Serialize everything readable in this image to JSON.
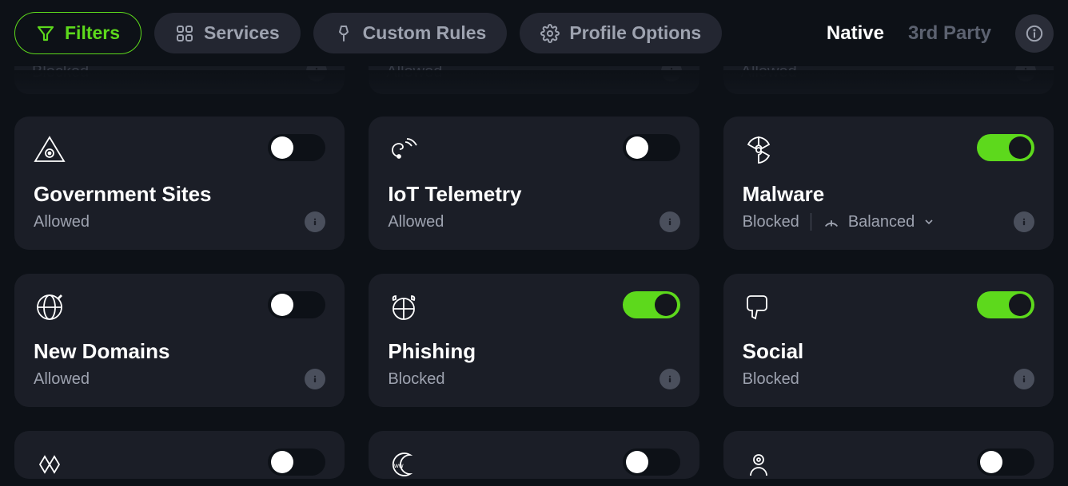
{
  "header": {
    "tabs": [
      {
        "id": "filters",
        "label": "Filters",
        "active": true
      },
      {
        "id": "services",
        "label": "Services",
        "active": false
      },
      {
        "id": "custom_rules",
        "label": "Custom Rules",
        "active": false
      },
      {
        "id": "profile_options",
        "label": "Profile Options",
        "active": false
      }
    ],
    "view_toggles": {
      "native_label": "Native",
      "third_party_label": "3rd Party"
    }
  },
  "partial_top": [
    {
      "status": "Blocked"
    },
    {
      "status": "Allowed"
    },
    {
      "status": "Allowed"
    }
  ],
  "cards": [
    {
      "id": "government",
      "title": "Government Sites",
      "status": "Allowed",
      "enabled": false
    },
    {
      "id": "iot",
      "title": "IoT Telemetry",
      "status": "Allowed",
      "enabled": false
    },
    {
      "id": "malware",
      "title": "Malware",
      "status": "Blocked",
      "enabled": true,
      "mode": "Balanced"
    },
    {
      "id": "newdomains",
      "title": "New Domains",
      "status": "Allowed",
      "enabled": false
    },
    {
      "id": "phishing",
      "title": "Phishing",
      "status": "Blocked",
      "enabled": true
    },
    {
      "id": "social",
      "title": "Social",
      "status": "Blocked",
      "enabled": true
    }
  ],
  "icon_names": {
    "government": "eye-triangle-icon",
    "iot": "signal-swirl-icon",
    "malware": "radioactive-icon",
    "newdomains": "globe-new-icon",
    "phishing": "devil-globe-icon",
    "social": "thumbs-down-icon"
  }
}
